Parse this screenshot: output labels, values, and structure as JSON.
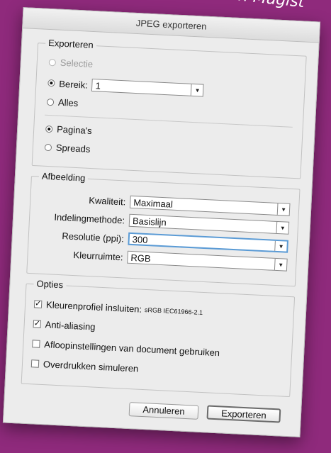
{
  "background": {
    "title_fragment": "in Magist",
    "color": "#8f2a7c"
  },
  "dialog": {
    "title": "JPEG exporteren",
    "export_group": {
      "legend": "Exporteren",
      "selection_label": "Selectie",
      "range_label": "Bereik:",
      "range_value": "1",
      "all_label": "Alles",
      "pages_label": "Pagina's",
      "spreads_label": "Spreads"
    },
    "image_group": {
      "legend": "Afbeelding",
      "quality_label": "Kwaliteit:",
      "quality_value": "Maximaal",
      "format_method_label": "Indelingmethode:",
      "format_method_value": "Basislijn",
      "resolution_label": "Resolutie (ppi):",
      "resolution_value": "300",
      "color_space_label": "Kleurruimte:",
      "color_space_value": "RGB"
    },
    "options_group": {
      "legend": "Opties",
      "embed_profile_label": "Kleurenprofiel insluiten:",
      "embed_profile_value": "sRGB IEC61966-2.1",
      "embed_profile_checked": true,
      "anti_alias_label": "Anti-aliasing",
      "anti_alias_checked": true,
      "bleed_label": "Afloopinstellingen van document gebruiken",
      "bleed_checked": false,
      "overprint_label": "Overdrukken simuleren",
      "overprint_checked": false
    },
    "buttons": {
      "cancel": "Annuleren",
      "export": "Exporteren"
    }
  }
}
